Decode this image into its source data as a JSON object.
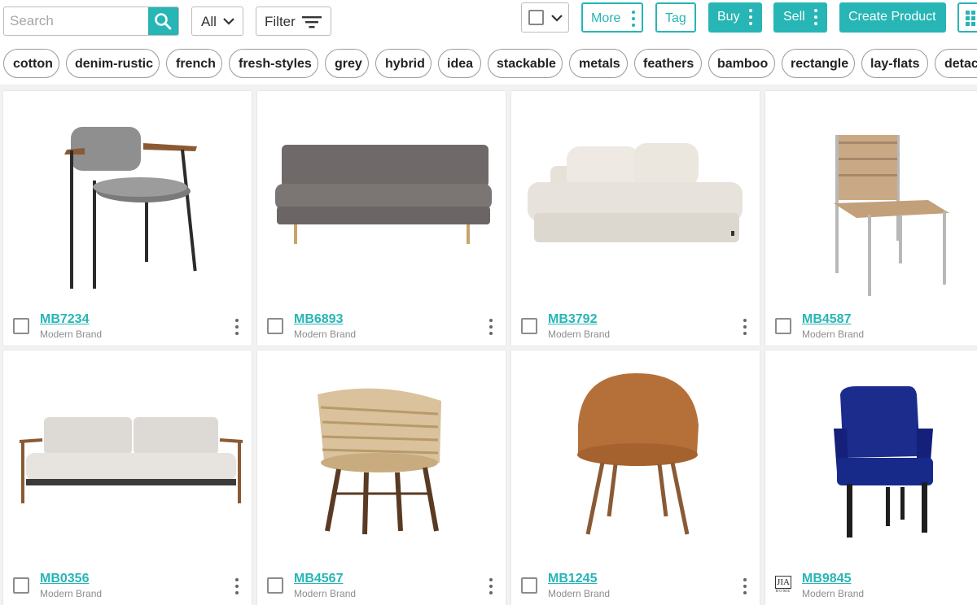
{
  "toolbar": {
    "search_placeholder": "Search",
    "scope_label": "All",
    "filter_label": "Filter",
    "more_label": "More",
    "tag_label": "Tag",
    "buy_label": "Buy",
    "sell_label": "Sell",
    "create_label": "Create Product",
    "accent_color": "#27b5b5"
  },
  "tags": [
    "cotton",
    "denim-rustic",
    "french",
    "fresh-styles",
    "grey",
    "hybrid",
    "idea",
    "stackable",
    "metals",
    "feathers",
    "bamboo",
    "rectangle",
    "lay-flats",
    "detac"
  ],
  "products": [
    {
      "sku": "MB7234",
      "brand": "Modern Brand",
      "image": "grey upholstered armchair with wood armrests"
    },
    {
      "sku": "MB6893",
      "brand": "Modern Brand",
      "image": "grey tufted sofa"
    },
    {
      "sku": "MB3792",
      "brand": "Modern Brand",
      "image": "white sectional chaise sofa"
    },
    {
      "sku": "MB4587",
      "brand": "Modern Brand",
      "image": "woven leather dining chair"
    },
    {
      "sku": "MB0356",
      "brand": "Modern Brand",
      "image": "light grey sofa with wood frame"
    },
    {
      "sku": "MB4567",
      "brand": "Modern Brand",
      "image": "rattan barrel chair"
    },
    {
      "sku": "MB1245",
      "brand": "Modern Brand",
      "image": "cognac leather dining chair"
    },
    {
      "sku": "MB9845",
      "brand": "Modern Brand",
      "image": "navy velvet wingback chair",
      "brand_logo": "JIA HOME"
    }
  ]
}
